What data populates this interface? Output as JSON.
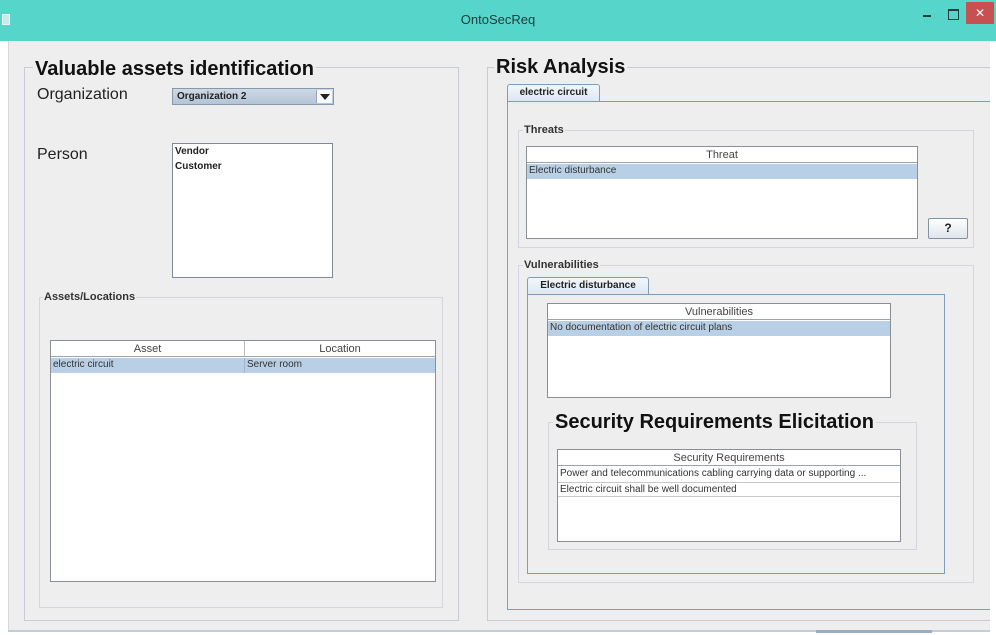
{
  "window": {
    "title": "OntoSecReq"
  },
  "assets_panel": {
    "title": "Valuable assets identification",
    "organization_label": "Organization",
    "organization_selected": "Organization 2",
    "person_label": "Person",
    "persons": [
      "Vendor",
      "Customer"
    ],
    "assets_locations_title": "Assets/Locations",
    "table": {
      "columns": [
        "Asset",
        "Location"
      ],
      "rows": [
        [
          "electric circuit",
          "Server room"
        ]
      ]
    }
  },
  "risk_panel": {
    "title": "Risk Analysis",
    "tab_label": "electric circuit",
    "threats_title": "Threats",
    "threats_table": {
      "columns": [
        "Threat"
      ],
      "rows": [
        [
          "Electric disturbance"
        ]
      ]
    },
    "help_label": "?",
    "vulnerabilities_title": "Vulnerabilities",
    "vuln_tab_label": "Electric disturbance",
    "vuln_table": {
      "columns": [
        "Vulnerabilities"
      ],
      "rows": [
        [
          "No documentation of electric circuit plans"
        ]
      ]
    },
    "sre_title": "Security Requirements Elicitation",
    "sr_table": {
      "columns": [
        "Security Requirements"
      ],
      "rows": [
        [
          "Power and telecommunications cabling carrying data or supporting ..."
        ],
        [
          "Electric circuit shall be well documented"
        ]
      ]
    }
  },
  "colors": {
    "titlebar": "#56d6cb",
    "close_button": "#c75050",
    "selection": "#b8cfe5"
  }
}
